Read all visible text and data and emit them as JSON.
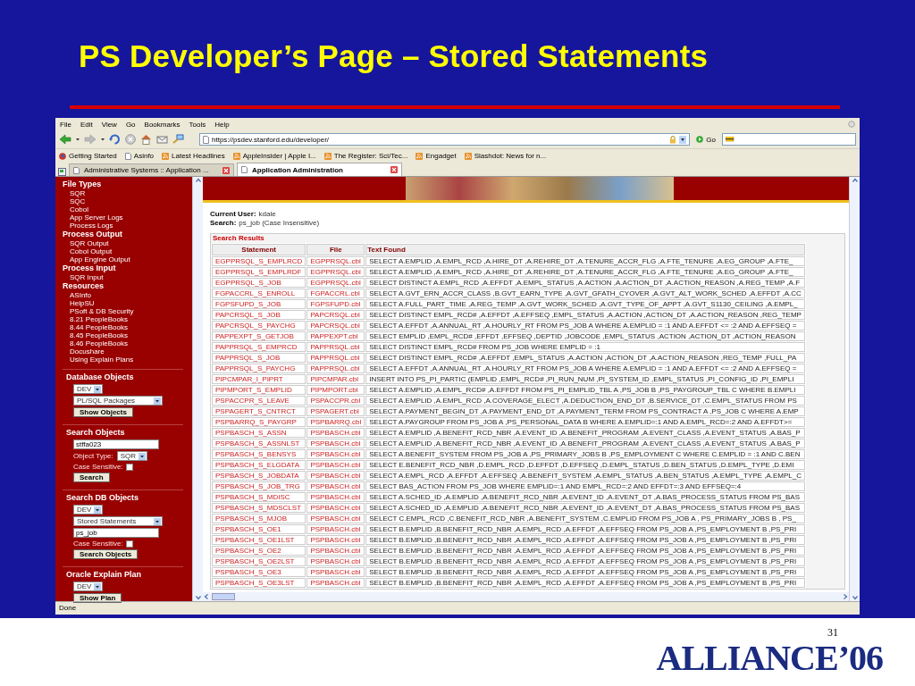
{
  "slide": {
    "title": "PS Developer’s Page – Stored Statements",
    "page_number": "31",
    "logo": "ALLIANCE’06"
  },
  "browser": {
    "menu": [
      "File",
      "Edit",
      "View",
      "Go",
      "Bookmarks",
      "Tools",
      "Help"
    ],
    "address": "https://psdev.stanford.edu/developer/",
    "go_label": "Go",
    "bookmarks": [
      {
        "label": "Getting Started",
        "kind": "site"
      },
      {
        "label": "Asinfo",
        "kind": "page"
      },
      {
        "label": "Latest Headlines",
        "kind": "feed"
      },
      {
        "label": "AppleInsider | Apple I...",
        "kind": "feed"
      },
      {
        "label": "The Register: Sci/Tec...",
        "kind": "feed"
      },
      {
        "label": "Engadget",
        "kind": "feed"
      },
      {
        "label": "Slashdot: News for n...",
        "kind": "feed"
      }
    ],
    "tabs": [
      {
        "label": "Administrative Systems :: Application ...",
        "selected": false
      },
      {
        "label": "Application Administration",
        "selected": true
      }
    ],
    "status": "Done"
  },
  "sidebar": {
    "sections": [
      {
        "kind": "menu",
        "heading": "File Types",
        "items": [
          "SQR",
          "SQC",
          "Cobol",
          "App Server Logs",
          "Process Logs"
        ]
      },
      {
        "kind": "menu",
        "heading": "Process Output",
        "items": [
          "SQR Output",
          "Cobol Output",
          "App Engine Output"
        ]
      },
      {
        "kind": "menu",
        "heading": "Process Input",
        "items": [
          "SQR Input"
        ]
      },
      {
        "kind": "menu",
        "heading": "Resources",
        "items": [
          "ASInfo",
          "HelpSU",
          "PSoft & DB Security",
          "8.21 PeopleBooks",
          "8.44 PeopleBooks",
          "8.45 PeopleBooks",
          "8.46 PeopleBooks",
          "Docushare",
          "Using Explain Plans"
        ]
      },
      {
        "kind": "form",
        "heading": "Database Objects",
        "controls": [
          {
            "kind": "select",
            "value": "DEV"
          },
          {
            "kind": "select",
            "value": "PL/SQL Packages"
          },
          {
            "kind": "button",
            "label": "Show Objects"
          }
        ]
      },
      {
        "kind": "form",
        "heading": "Search Objects",
        "controls": [
          {
            "kind": "input",
            "value": "stffa023"
          },
          {
            "kind": "labeled_select",
            "label": "Object Type:",
            "value": "SQR"
          },
          {
            "kind": "checkbox",
            "label": "Case Sensitive:",
            "checked": false
          },
          {
            "kind": "button",
            "label": "Search"
          }
        ]
      },
      {
        "kind": "form",
        "heading": "Search DB Objects",
        "controls": [
          {
            "kind": "select",
            "value": "DEV"
          },
          {
            "kind": "select",
            "value": "Stored Statements"
          },
          {
            "kind": "input",
            "value": "ps_job"
          },
          {
            "kind": "checkbox",
            "label": "Case Sensitive:",
            "checked": false
          },
          {
            "kind": "button",
            "label": "Search Objects"
          }
        ]
      },
      {
        "kind": "form",
        "heading": "Oracle Explain Plan",
        "controls": [
          {
            "kind": "select",
            "value": "DEV"
          },
          {
            "kind": "button",
            "label": "Show Plan"
          }
        ]
      }
    ]
  },
  "main": {
    "user_label": "Current User:",
    "user": "kdale",
    "search_label": "Search:",
    "search": "ps_job  (Case Insensitive)",
    "results": {
      "title": "Search Results",
      "columns": [
        "Statement",
        "File",
        "Text Found"
      ],
      "rows": [
        [
          "EGPPRSQL_S_EMPLRCD",
          "EGPPRSQL.cbl",
          "SELECT A.EMPLID ,A.EMPL_RCD ,A.HIRE_DT ,A.REHIRE_DT ,A.TENURE_ACCR_FLG ,A.FTE_TENURE ,A.EG_GROUP ,A.FTE_"
        ],
        [
          "EGPPRSQL_S_EMPLRDF",
          "EGPPRSQL.cbl",
          "SELECT A.EMPLID ,A.EMPL_RCD ,A.HIRE_DT ,A.REHIRE_DT ,A.TENURE_ACCR_FLG ,A.FTE_TENURE ,A.EG_GROUP ,A.FTE_"
        ],
        [
          "EGPPRSQL_S_JOB",
          "EGPPRSQL.cbl",
          "SELECT DISTINCT A.EMPL_RCD ,A.EFFDT ,A.EMPL_STATUS ,A.ACTION ,A.ACTION_DT ,A.ACTION_REASON ,A.REG_TEMP ,A.F"
        ],
        [
          "FGPACCRL_S_ENROLL",
          "FGPACCRL.cbl",
          "SELECT A.GVT_ERN_ACCR_CLASS ,B.GVT_EARN_TYPE ,A.GVT_GFATH_CYOVER ,A.GVT_ALT_WORK_SCHED ,A.EFFDT ,A.CC"
        ],
        [
          "FGPSFUPD_S_JOB",
          "FGPSFUPD.cbl",
          "SELECT A.FULL_PART_TIME ,A.REG_TEMP ,A.GVT_WORK_SCHED ,A.GVT_TYPE_OF_APPT ,A.GVT_S1130_CEILING ,A.EMPL_"
        ],
        [
          "PAPCRSQL_S_JOB",
          "PAPCRSQL.cbl",
          "SELECT DISTINCT EMPL_RCD# ,A.EFFDT ,A.EFFSEQ ,EMPL_STATUS ,A.ACTION ,ACTION_DT ,A.ACTION_REASON ,REG_TEMP"
        ],
        [
          "PAPCRSQL_S_PAYCHG",
          "PAPCRSQL.cbl",
          "SELECT A.EFFDT ,A.ANNUAL_RT ,A.HOURLY_RT FROM PS_JOB A WHERE A.EMPLID = :1 AND A.EFFDT <= :2 AND A.EFFSEQ ="
        ],
        [
          "PAPPEXPT_S_GETJOB",
          "PAPPEXPT.cbl",
          "SELECT EMPLID ,EMPL_RCD# ,EFFDT ,EFFSEQ ,DEPTID ,JOBCODE ,EMPL_STATUS ,ACTION ,ACTION_DT ,ACTION_REASON"
        ],
        [
          "PAPPRSQL_S_EMPRCD",
          "PAPPRSQL.cbl",
          "SELECT DISTINCT EMPL_RCD# FROM PS_JOB WHERE EMPLID = :1"
        ],
        [
          "PAPPRSQL_S_JOB",
          "PAPPRSQL.cbl",
          "SELECT DISTINCT EMPL_RCD# ,A.EFFDT ,EMPL_STATUS ,A.ACTION ,ACTION_DT ,A.ACTION_REASON ,REG_TEMP ,FULL_PA"
        ],
        [
          "PAPPRSQL_S_PAYCHG",
          "PAPPRSQL.cbl",
          "SELECT A.EFFDT ,A.ANNUAL_RT ,A.HOURLY_RT FROM PS_JOB A WHERE A.EMPLID = :1 AND A.EFFDT <= :2 AND A.EFFSEQ ="
        ],
        [
          "PIPCMPAR_I_PIPRT",
          "PIPCMPAR.cbl",
          "INSERT INTO PS_PI_PARTIC (EMPLID ,EMPL_RCD# ,PI_RUN_NUM ,PI_SYSTEM_ID ,EMPL_STATUS ,PI_CONFIG_ID ,PI_EMPLI"
        ],
        [
          "PIPMPORT_S_EMPLID",
          "PIPMPORT.cbl",
          "SELECT A.EMPLID ,A.EMPL_RCD# ,A.EFFDT FROM PS_PI_EMPLID_TBL A ,PS_JOB B ,PS_PAYGROUP_TBL C WHERE B.EMPLI"
        ],
        [
          "PSPACCPR_S_LEAVE",
          "PSPACCPR.cbl",
          "SELECT A.EMPLID ,A.EMPL_RCD ,A.COVERAGE_ELECT ,A.DEDUCTION_END_DT ,B.SERVICE_DT ,C.EMPL_STATUS FROM PS"
        ],
        [
          "PSPAGERT_S_CNTRCT",
          "PSPAGERT.cbl",
          "SELECT A.PAYMENT_BEGIN_DT ,A.PAYMENT_END_DT ,A.PAYMENT_TERM FROM PS_CONTRACT A ,PS_JOB C WHERE A.EMP"
        ],
        [
          "PSPBARRQ_S_PAYGRP",
          "PSPBARRQ.cbl",
          "SELECT A.PAYGROUP FROM PS_JOB A ,PS_PERSONAL_DATA B WHERE A.EMPLID=:1 AND A.EMPL_RCD=:2 AND A.EFFDT>="
        ],
        [
          "PSPBASCH_S_ASSN",
          "PSPBASCH.cbl",
          "SELECT A.EMPLID ,A.BENEFIT_RCD_NBR ,A.EVENT_ID ,A.BENEFIT_PROGRAM ,A.EVENT_CLASS ,A.EVENT_STATUS ,A.BAS_P"
        ],
        [
          "PSPBASCH_S_ASSNLST",
          "PSPBASCH.cbl",
          "SELECT A.EMPLID ,A.BENEFIT_RCD_NBR ,A.EVENT_ID ,A.BENEFIT_PROGRAM ,A.EVENT_CLASS ,A.EVENT_STATUS ,A.BAS_P"
        ],
        [
          "PSPBASCH_S_BENSYS",
          "PSPBASCH.cbl",
          "SELECT A.BENEFIT_SYSTEM FROM PS_JOB A ,PS_PRIMARY_JOBS B ,PS_EMPLOYMENT C WHERE C.EMPLID = :1 AND C.BEN"
        ],
        [
          "PSPBASCH_S_ELGDATA",
          "PSPBASCH.cbl",
          "SELECT E.BENEFIT_RCD_NBR ,D.EMPL_RCD ,D.EFFDT ,D.EFFSEQ ,D.EMPL_STATUS ,D.BEN_STATUS ,D.EMPL_TYPE ,D.EMI"
        ],
        [
          "PSPBASCH_S_JOBDATA",
          "PSPBASCH.cbl",
          "SELECT A.EMPL_RCD ,A.EFFDT ,A.EFFSEQ ,A.BENEFIT_SYSTEM ,A.EMPL_STATUS ,A.BEN_STATUS ,A.EMPL_TYPE ,A.EMPL_C"
        ],
        [
          "PSPBASCH_S_JOB_TRG",
          "PSPBASCH.cbl",
          "SELECT BAS_ACTION FROM PS_JOB WHERE EMPLID=:1 AND EMPL_RCD=:2 AND EFFDT=:3 AND EFFSEQ=:4"
        ],
        [
          "PSPBASCH_S_MDISC",
          "PSPBASCH.cbl",
          "SELECT A.SCHED_ID ,A.EMPLID ,A.BENEFIT_RCD_NBR ,A.EVENT_ID ,A.EVENT_DT ,A.BAS_PROCESS_STATUS FROM PS_BAS"
        ],
        [
          "PSPBASCH_S_MDSCLST",
          "PSPBASCH.cbl",
          "SELECT A.SCHED_ID ,A.EMPLID ,A.BENEFIT_RCD_NBR ,A.EVENT_ID ,A.EVENT_DT ,A.BAS_PROCESS_STATUS FROM PS_BAS"
        ],
        [
          "PSPBASCH_S_MJOB",
          "PSPBASCH.cbl",
          "SELECT C.EMPL_RCD ,C.BENEFIT_RCD_NBR ,A.BENEFIT_SYSTEM ,C.EMPLID FROM PS_JOB A , PS_PRIMARY_JOBS B , PS_"
        ],
        [
          "PSPBASCH_S_OE1",
          "PSPBASCH.cbl",
          "SELECT B.EMPLID ,B.BENEFIT_RCD_NBR ,A.EMPL_RCD ,A.EFFDT ,A.EFFSEQ FROM PS_JOB A ,PS_EMPLOYMENT B ,PS_PRI"
        ],
        [
          "PSPBASCH_S_OE1LST",
          "PSPBASCH.cbl",
          "SELECT B.EMPLID ,B.BENEFIT_RCD_NBR ,A.EMPL_RCD ,A.EFFDT ,A.EFFSEQ FROM PS_JOB A ,PS_EMPLOYMENT B ,PS_PRI"
        ],
        [
          "PSPBASCH_S_OE2",
          "PSPBASCH.cbl",
          "SELECT B.EMPLID ,B.BENEFIT_RCD_NBR ,A.EMPL_RCD ,A.EFFDT ,A.EFFSEQ FROM PS_JOB A ,PS_EMPLOYMENT B ,PS_PRI"
        ],
        [
          "PSPBASCH_S_OE2LST",
          "PSPBASCH.cbl",
          "SELECT B.EMPLID ,B.BENEFIT_RCD_NBR ,A.EMPL_RCD ,A.EFFDT ,A.EFFSEQ FROM PS_JOB A ,PS_EMPLOYMENT B ,PS_PRI"
        ],
        [
          "PSPBASCH_S_OE3",
          "PSPBASCH.cbl",
          "SELECT B.EMPLID ,B.BENEFIT_RCD_NBR ,A.EMPL_RCD ,A.EFFDT ,A.EFFSEQ FROM PS_JOB A ,PS_EMPLOYMENT B ,PS_PRI"
        ],
        [
          "PSPBASCH_S_OE3LST",
          "PSPBASCH.cbl",
          "SELECT B.EMPLID ,B.BENEFIT_RCD_NBR ,A.EMPL_RCD ,A.EFFDT ,A.EFFSEQ FROM PS_JOB A ,PS_EMPLOYMENT B ,PS_PRI"
        ]
      ]
    }
  }
}
